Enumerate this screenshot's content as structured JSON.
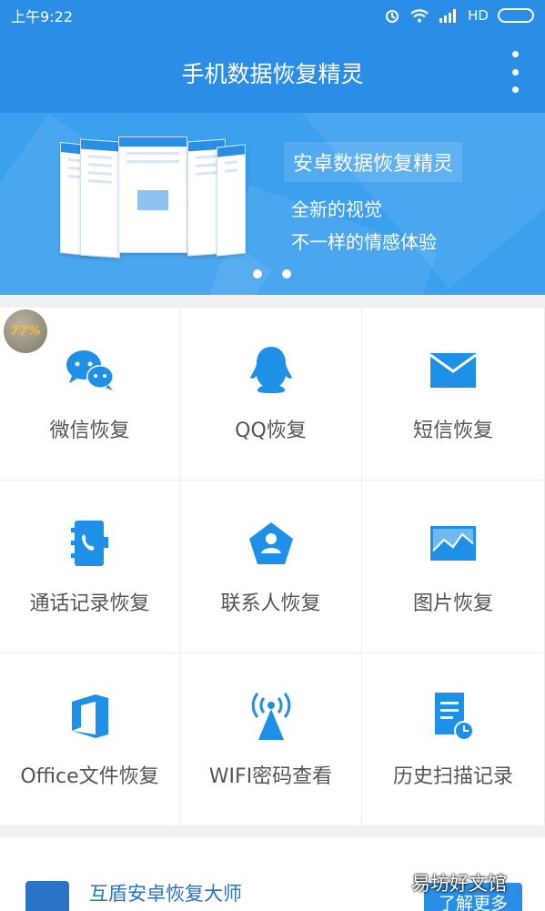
{
  "status_bar": {
    "time": "上午9:22",
    "network": "HD"
  },
  "app_bar": {
    "title": "手机数据恢复精灵",
    "menu_icon": "more-vertical-icon"
  },
  "banner": {
    "title": "安卓数据恢复精灵",
    "line1": "全新的视觉",
    "line2": "不一样的情感体验",
    "page_count": 2
  },
  "badge": {
    "text": "77%"
  },
  "features": [
    {
      "label": "微信恢复",
      "icon": "wechat-icon"
    },
    {
      "label": "QQ恢复",
      "icon": "qq-penguin-icon"
    },
    {
      "label": "短信恢复",
      "icon": "envelope-icon"
    },
    {
      "label": "通话记录恢复",
      "icon": "call-log-icon"
    },
    {
      "label": "联系人恢复",
      "icon": "contact-icon"
    },
    {
      "label": "图片恢复",
      "icon": "image-icon"
    },
    {
      "label": "Office文件恢复",
      "icon": "office-icon"
    },
    {
      "label": "WIFI密码查看",
      "icon": "wifi-signal-icon"
    },
    {
      "label": "历史扫描记录",
      "icon": "history-doc-icon"
    }
  ],
  "promo": {
    "name": "互盾安卓恢复大师",
    "button": "了解更多"
  },
  "watermark": "易坊好文馆",
  "colors": {
    "primary": "#2a8ee6",
    "icon_blue": "#1e90e8",
    "label_gray": "#555555"
  }
}
